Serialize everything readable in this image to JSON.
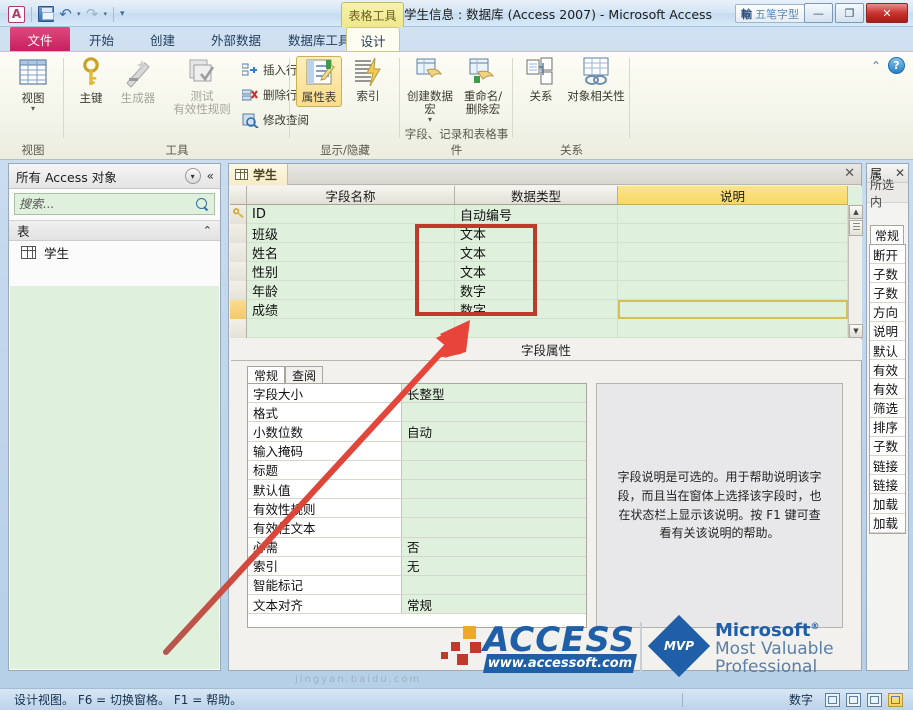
{
  "window": {
    "title": "学生信息 : 数据库 (Access 2007)  -  Microsoft Access",
    "contextual_tab_group": "表格工具",
    "ime_glyph": "輸",
    "ime_label": "五笔字型",
    "minimize": "—",
    "maximize": "❐",
    "close": "✕"
  },
  "quick_access": {
    "app_logo": "A",
    "save": "save-icon",
    "undo": "↶",
    "undo_caret": "▾",
    "redo": "↷",
    "redo_caret": "▾",
    "customize": "▾"
  },
  "ribbon": {
    "tabs": [
      {
        "label": "文件",
        "kind": "file"
      },
      {
        "label": "开始",
        "kind": "normal"
      },
      {
        "label": "创建",
        "kind": "normal"
      },
      {
        "label": "外部数据",
        "kind": "normal"
      },
      {
        "label": "数据库工具",
        "kind": "normal"
      },
      {
        "label": "设计",
        "kind": "selected"
      }
    ],
    "help_icon": "?",
    "collapse_icon": "⌃",
    "groups": [
      {
        "label": "视图",
        "buttons": [
          {
            "label": "视图",
            "caret": "▾"
          }
        ]
      },
      {
        "label": "工具",
        "buttons": [
          {
            "label": "主键"
          },
          {
            "label": "生成器",
            "dim": true
          },
          {
            "label": "测试\n有效性规则",
            "dim": true
          }
        ],
        "small_buttons": [
          {
            "label": "插入行"
          },
          {
            "label": "删除行"
          },
          {
            "label": "修改查阅"
          }
        ]
      },
      {
        "label": "显示/隐藏",
        "buttons": [
          {
            "label": "属性表",
            "active": true
          },
          {
            "label": "索引"
          }
        ]
      },
      {
        "label": "字段、记录和表格事件",
        "buttons": [
          {
            "label": "创建数据宏",
            "caret": "▾"
          },
          {
            "label": "重命名/\n删除宏"
          }
        ]
      },
      {
        "label": "关系",
        "buttons": [
          {
            "label": "关系"
          },
          {
            "label": "对象相关性"
          }
        ]
      }
    ]
  },
  "nav_pane": {
    "title": "所有 Access 对象",
    "dropdown_icon": "▾",
    "collapse_icon": "«",
    "search_placeholder": "搜索...",
    "search_value": "",
    "search_icon": "search-icon",
    "group_label": "表",
    "group_chevron": "⌃",
    "items": [
      {
        "label": "学生",
        "icon": "table-icon"
      }
    ]
  },
  "document": {
    "tab_label": "学生",
    "close_label": "✕",
    "columns": [
      "字段名称",
      "数据类型",
      "说明"
    ],
    "rows": [
      {
        "selector": "key",
        "name": "ID",
        "type": "自动编号",
        "desc": ""
      },
      {
        "selector": "",
        "name": "班级",
        "type": "文本",
        "desc": ""
      },
      {
        "selector": "",
        "name": "姓名",
        "type": "文本",
        "desc": ""
      },
      {
        "selector": "",
        "name": "性别",
        "type": "文本",
        "desc": ""
      },
      {
        "selector": "",
        "name": "年龄",
        "type": "数字",
        "desc": ""
      },
      {
        "selector": "current",
        "name": "成绩",
        "type": "数字",
        "desc": "",
        "focused": true
      },
      {
        "selector": "",
        "name": "",
        "type": "",
        "desc": ""
      }
    ],
    "scroll_up": "▲",
    "scroll_down": "▼"
  },
  "field_properties": {
    "title": "字段属性",
    "tabs": [
      {
        "label": "常规",
        "active": true
      },
      {
        "label": "查阅",
        "active": false
      }
    ],
    "rows": [
      {
        "name": "字段大小",
        "value": "长整型"
      },
      {
        "name": "格式",
        "value": ""
      },
      {
        "name": "小数位数",
        "value": "自动"
      },
      {
        "name": "输入掩码",
        "value": ""
      },
      {
        "name": "标题",
        "value": ""
      },
      {
        "name": "默认值",
        "value": ""
      },
      {
        "name": "有效性规则",
        "value": ""
      },
      {
        "name": "有效性文本",
        "value": ""
      },
      {
        "name": "必需",
        "value": "否"
      },
      {
        "name": "索引",
        "value": "无"
      },
      {
        "name": "智能标记",
        "value": ""
      },
      {
        "name": "文本对齐",
        "value": "常规"
      }
    ],
    "help_text": "字段说明是可选的。用于帮助说明该字段，而且当在窗体上选择该字段时，也在状态栏上显示该说明。按 F1 键可查看有关该说明的帮助。"
  },
  "property_sheet": {
    "title": "属",
    "close_label": "✕",
    "subtitle": "所选内",
    "tab_label": "常规",
    "rows": [
      "断开",
      "子数",
      "子数",
      "方向",
      "说明",
      "默认",
      "有效",
      "有效",
      "筛选",
      "排序",
      "子数",
      "链接",
      "链接",
      "加载",
      "加载"
    ]
  },
  "status_bar": {
    "message": "设计视图。  F6 = 切换窗格。  F1 = 帮助。",
    "mode": "数字",
    "view_buttons": [
      "datasheet-view",
      "pivottable-view",
      "pivotchart-view",
      "design-view"
    ]
  },
  "watermark": {
    "access_text": "ACCESS",
    "access_url": "www.accessoft.com",
    "mvp_badge": "MVP",
    "ms_line1": "Microsoft",
    "ms_reg": "®",
    "ms_line2": "Most Valuable",
    "ms_line3": "Professional",
    "footer_url": "jingyan.baidu.com"
  },
  "colors": {
    "accent_red": "#c0392b",
    "grid_green": "#dff0dc",
    "header_yellow": "#f7d766",
    "file_tab": "#c5205c",
    "logo_blue": "#1f5fa8"
  }
}
